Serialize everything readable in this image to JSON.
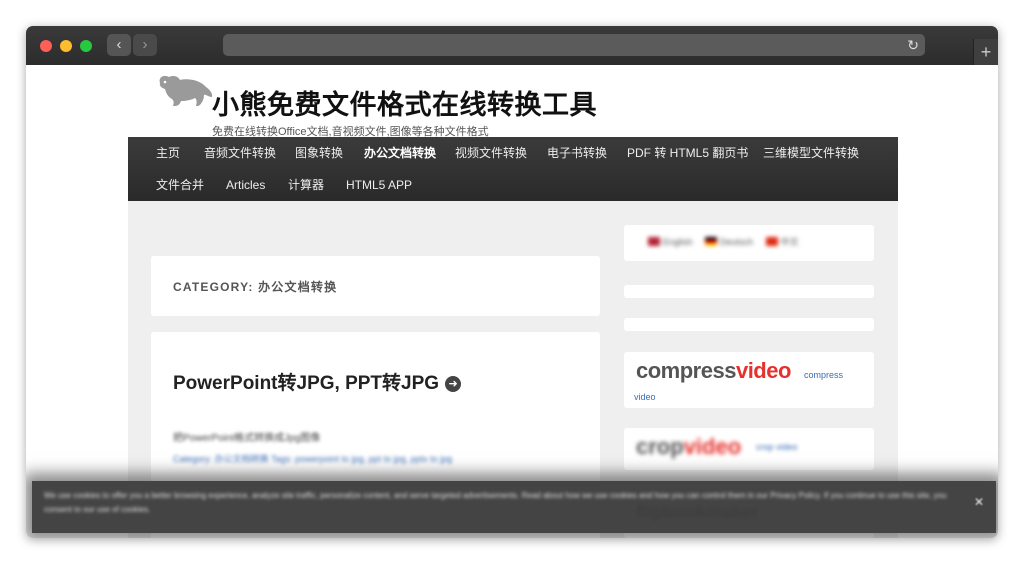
{
  "browser": {
    "back_glyph": "‹",
    "forward_glyph": "›",
    "reload_glyph": "↻",
    "new_tab_glyph": "+",
    "address": ""
  },
  "site": {
    "title": "小熊免费文件格式在线转换工具",
    "description": "免费在线转换Office文档,音视频文件,图像等各种文件格式"
  },
  "menu": {
    "items": [
      {
        "label": "主页"
      },
      {
        "label": "音频文件转换"
      },
      {
        "label": "图象转换"
      },
      {
        "label": "办公文档转换",
        "current": true
      },
      {
        "label": "视频文件转换"
      },
      {
        "label": "电子书转换"
      },
      {
        "label": "PDF 转 HTML5 翻页书"
      },
      {
        "label": "三维模型文件转换"
      },
      {
        "label": "文件合并"
      },
      {
        "label": "Articles"
      },
      {
        "label": "计算器"
      },
      {
        "label": "HTML5 APP"
      }
    ]
  },
  "archive": {
    "title": "CATEGORY: 办公文档转换"
  },
  "post": {
    "title": "PowerPoint转JPG, PPT转JPG",
    "excerpt": "把PowerPoint格式转换成Jpg图像",
    "meta": "Category: 办公文档转换 Tags: powerpoint to jpg, ppt to jpg, pptx to jpg"
  },
  "sidebar": {
    "languages": [
      "English",
      "Deutsch",
      "中文"
    ],
    "compress": {
      "logo_part1": "compress",
      "logo_part2": "video",
      "link_text": "compress video"
    },
    "crop": {
      "logo_part1": "crop",
      "logo_part2": "video",
      "link_text": "crop video"
    },
    "bottom": {
      "logo_text": "flipbookmaker"
    }
  },
  "cookie": {
    "text": "We use cookies to offer you a better browsing experience, analyze site traffic, personalize content, and serve targeted advertisements. Read about how we use cookies and how you can control them in our Privacy Policy. If you continue to use this site, you consent to our use of cookies.",
    "close_glyph": "✕"
  },
  "colors": {
    "menu_bg": "#2f2f2f",
    "accent_red": "#e6312d",
    "link_blue": "#3a6db5"
  }
}
